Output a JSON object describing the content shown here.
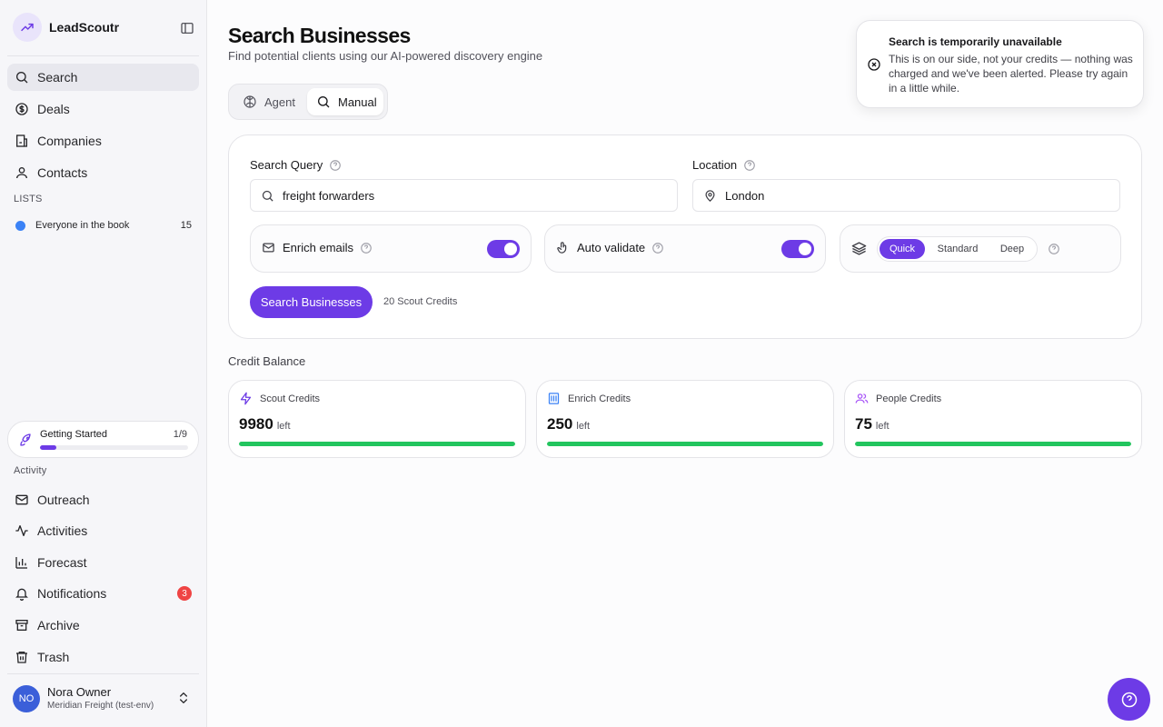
{
  "app": {
    "name": "LeadScoutr"
  },
  "sidebar": {
    "nav": [
      {
        "label": "Search",
        "icon": "search-icon",
        "active": true
      },
      {
        "label": "Deals",
        "icon": "dollar-icon"
      },
      {
        "label": "Companies",
        "icon": "building-icon"
      },
      {
        "label": "Contacts",
        "icon": "user-icon"
      }
    ],
    "lists_label": "LISTS",
    "lists": [
      {
        "label": "Everyone in the book",
        "count": "15",
        "color": "#3b82f6"
      }
    ],
    "getting_started": {
      "label": "Getting Started",
      "count": "1/9",
      "progress": 0.11
    },
    "activity_label": "Activity",
    "activity": [
      {
        "label": "Outreach",
        "icon": "mail-icon"
      },
      {
        "label": "Activities",
        "icon": "activity-icon"
      },
      {
        "label": "Forecast",
        "icon": "bar-chart-icon"
      },
      {
        "label": "Notifications",
        "icon": "bell-icon",
        "badge": "3"
      },
      {
        "label": "Archive",
        "icon": "archive-icon"
      },
      {
        "label": "Trash",
        "icon": "trash-icon"
      }
    ],
    "user": {
      "initials": "NO",
      "name": "Nora Owner",
      "org": "Meridian Freight (test-env)"
    }
  },
  "page": {
    "title": "Search Businesses",
    "subtitle": "Find potential clients using our AI-powered discovery engine"
  },
  "mode_toggle": {
    "agent_label": "Agent",
    "manual_label": "Manual",
    "selected": "Manual"
  },
  "search_form": {
    "query_label": "Search Query",
    "query_value": "freight forwarders",
    "location_label": "Location",
    "location_value": "London",
    "enrich_emails_label": "Enrich emails",
    "enrich_emails_on": true,
    "auto_validate_label": "Auto validate",
    "auto_validate_on": true,
    "depth_options": [
      "Quick",
      "Standard",
      "Deep"
    ],
    "depth_selected": "Quick",
    "submit_label": "Search Businesses",
    "cost_text": "20 Scout Credits"
  },
  "credits": {
    "section_title": "Credit Balance",
    "left_label": "left",
    "cards": [
      {
        "label": "Scout Credits",
        "value": "9980",
        "icon": "zap-icon",
        "fill": 1.0
      },
      {
        "label": "Enrich Credits",
        "value": "250",
        "icon": "building-icon",
        "fill": 1.0
      },
      {
        "label": "People Credits",
        "value": "75",
        "icon": "users-icon",
        "fill": 1.0
      }
    ]
  },
  "toast": {
    "title": "Search is temporarily unavailable",
    "body": "This is on our side, not your credits — nothing was charged and we've been alerted. Please try again in a little while."
  },
  "colors": {
    "accent": "#6d3be6",
    "success": "#22c55e",
    "danger": "#ef4444"
  }
}
